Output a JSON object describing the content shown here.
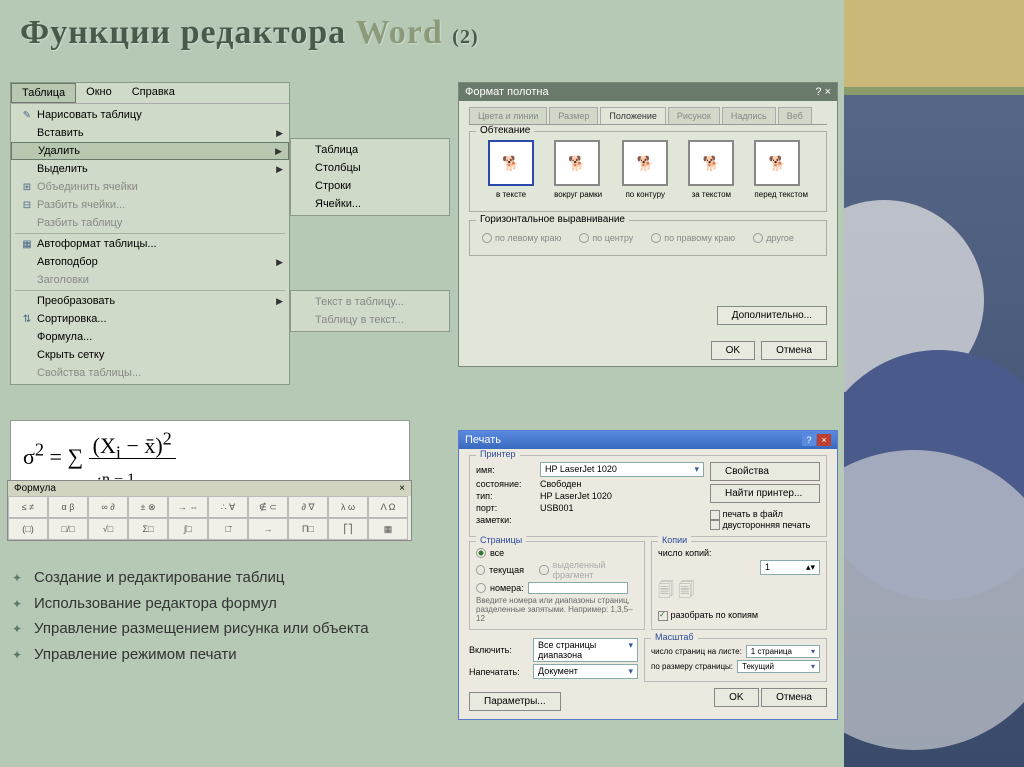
{
  "title": {
    "main": "Функции редактора",
    "word": "Word",
    "sub": "(2)"
  },
  "menu": {
    "menubar": [
      "Таблица",
      "Окно",
      "Справка"
    ],
    "items": [
      {
        "icon": "✎",
        "label": "Нарисовать таблицу"
      },
      {
        "icon": "",
        "label": "Вставить",
        "arrow": true
      },
      {
        "icon": "",
        "label": "Удалить",
        "arrow": true,
        "selected": true
      },
      {
        "icon": "",
        "label": "Выделить",
        "arrow": true
      },
      {
        "icon": "⊞",
        "label": "Объединить ячейки",
        "disabled": true
      },
      {
        "icon": "⊟",
        "label": "Разбить ячейки...",
        "disabled": true
      },
      {
        "icon": "",
        "label": "Разбить таблицу",
        "disabled": true
      },
      {
        "sep": true
      },
      {
        "icon": "▦",
        "label": "Автоформат таблицы..."
      },
      {
        "icon": "",
        "label": "Автоподбор",
        "arrow": true
      },
      {
        "icon": "",
        "label": "Заголовки",
        "disabled": true
      },
      {
        "sep": true
      },
      {
        "icon": "",
        "label": "Преобразовать",
        "arrow": true
      },
      {
        "icon": "⇅",
        "label": "Сортировка..."
      },
      {
        "icon": "",
        "label": "Формула..."
      },
      {
        "icon": "",
        "label": "Скрыть сетку"
      },
      {
        "icon": "",
        "label": "Свойства таблицы...",
        "disabled": true
      }
    ],
    "submenu1": [
      "Таблица",
      "Столбцы",
      "Строки",
      "Ячейки..."
    ],
    "submenu2": [
      "Текст в таблицу...",
      "Таблицу в текст..."
    ]
  },
  "formula_toolbar_title": "Формула",
  "bullets": [
    "Создание и редактирование таблиц",
    "Использование редактора формул",
    "Управление размещением рисунка или объекта",
    "Управление режимом печати"
  ],
  "format": {
    "title": "Формат полотна",
    "tabs": [
      "Цвета и линии",
      "Размер",
      "Положение",
      "Рисунок",
      "Надпись",
      "Веб"
    ],
    "active_tab": 2,
    "wrap_label": "Обтекание",
    "wrap_options": [
      "в тексте",
      "вокруг рамки",
      "по контуру",
      "за текстом",
      "перед текстом"
    ],
    "align_label": "Горизонтальное выравнивание",
    "align_options": [
      "по левому краю",
      "по центру",
      "по правому краю",
      "другое"
    ],
    "extra_btn": "Дополнительно...",
    "ok": "OK",
    "cancel": "Отмена"
  },
  "print": {
    "title": "Печать",
    "printer_group": "Принтер",
    "printer_name_lbl": "имя:",
    "printer_name": "HP LaserJet 1020",
    "status_lbl": "состояние:",
    "status": "Свободен",
    "type_lbl": "тип:",
    "type": "HP LaserJet 1020",
    "port_lbl": "порт:",
    "port": "USB001",
    "notes_lbl": "заметки:",
    "props_btn": "Свойства",
    "find_btn": "Найти принтер...",
    "chk_file": "печать в файл",
    "chk_duplex": "двусторонняя печать",
    "pages_group": "Страницы",
    "pages_all": "все",
    "pages_current": "текущая",
    "pages_sel": "выделенный фрагмент",
    "pages_num": "номера:",
    "pages_hint": "Введите номера или диапазоны страниц, разделенные запятыми. Например: 1,3,5–12",
    "copies_group": "Копии",
    "copies_lbl": "число копий:",
    "copies_val": "1",
    "collate": "разобрать по копиям",
    "include_lbl": "Включить:",
    "include_val": "Все страницы диапазона",
    "print_lbl": "Напечатать:",
    "print_val": "Документ",
    "scale_group": "Масштаб",
    "scale_pages_lbl": "число страниц на листе:",
    "scale_pages_val": "1 страница",
    "scale_size_lbl": "по размеру страницы:",
    "scale_size_val": "Текущий",
    "params_btn": "Параметры...",
    "ok": "OK",
    "cancel": "Отмена"
  }
}
